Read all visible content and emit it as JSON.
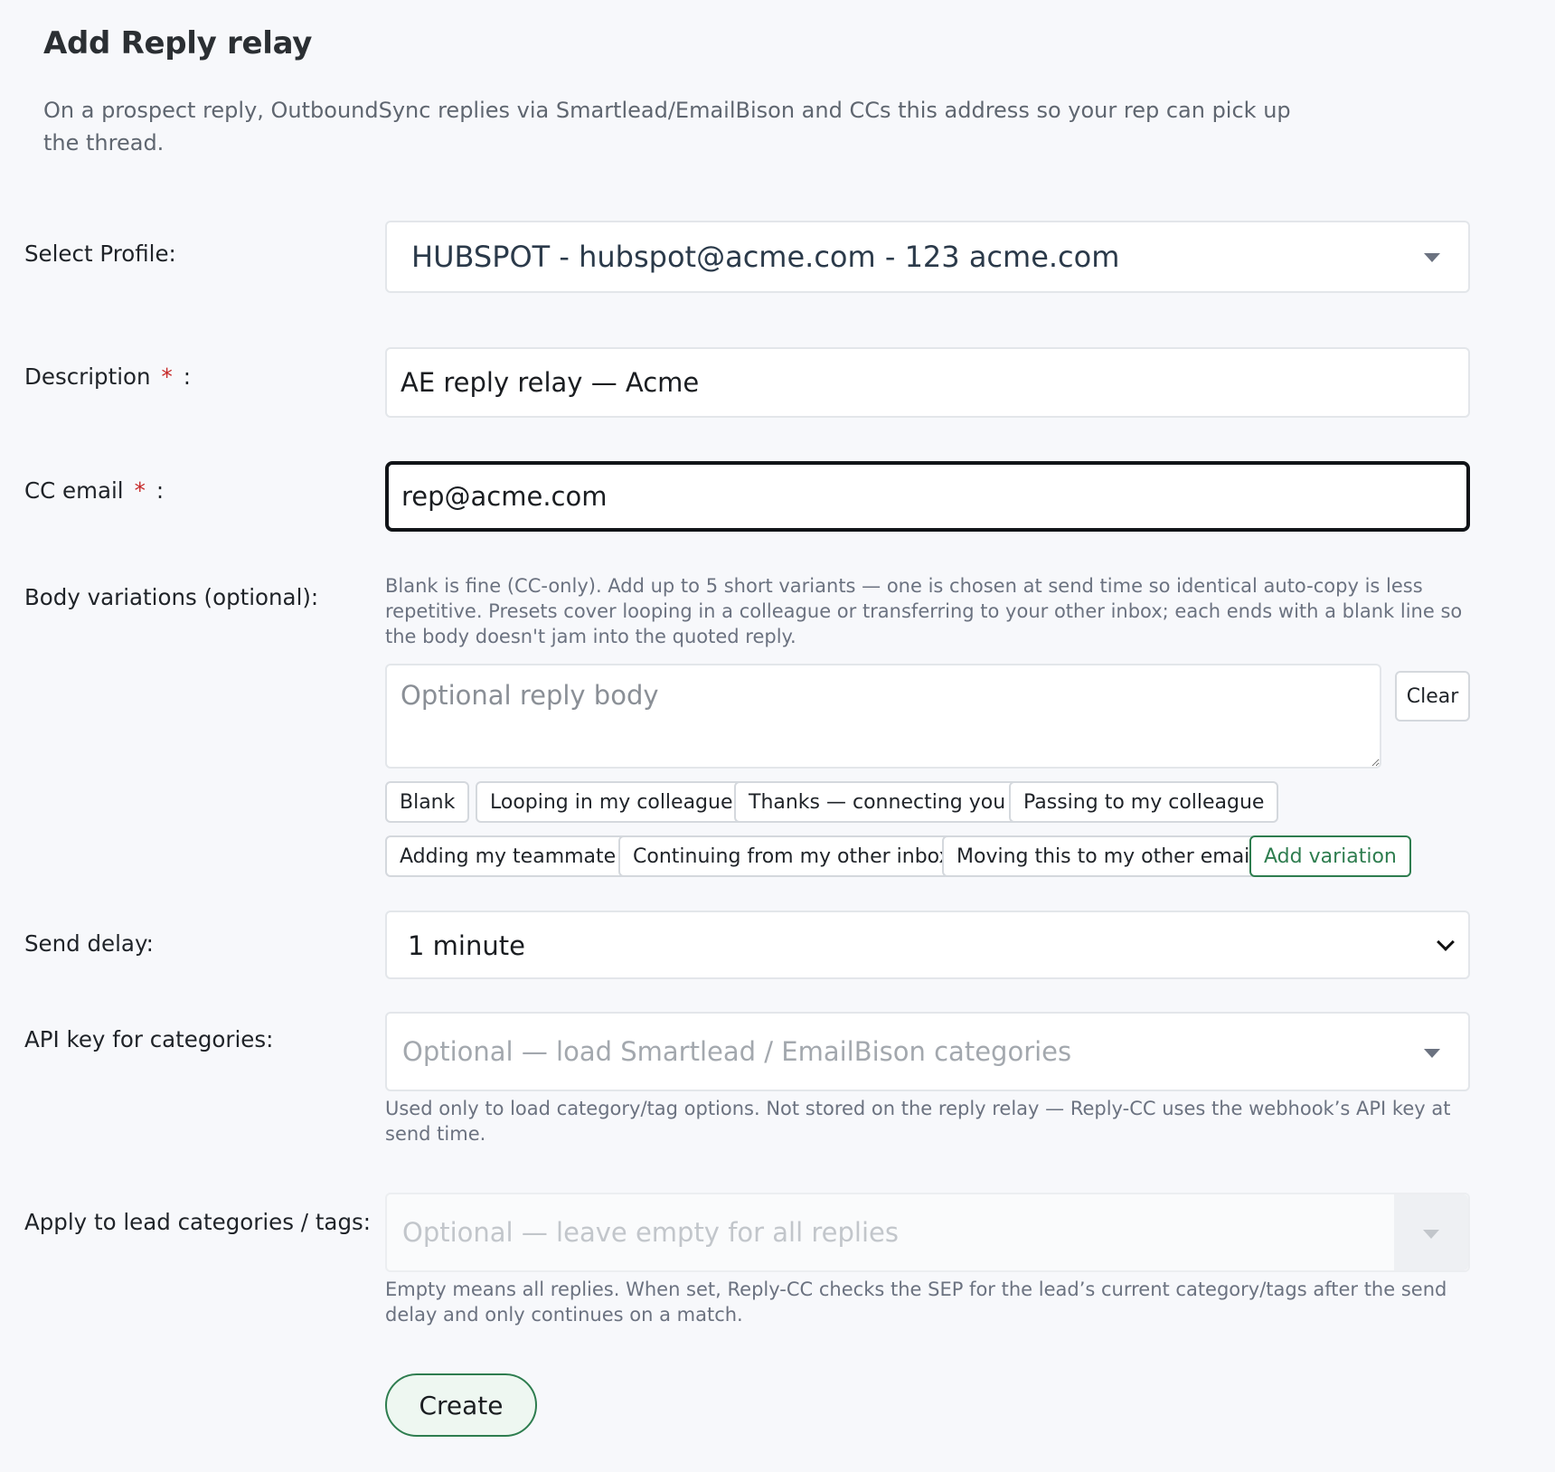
{
  "page": {
    "title": "Add Reply relay",
    "description": "On a prospect reply, OutboundSync replies via Smartlead/EmailBison and CCs this address so your rep can pick up the thread."
  },
  "profile": {
    "label": "Select Profile:",
    "value": "HUBSPOT - hubspot@acme.com - 123 acme.com"
  },
  "description_field": {
    "label": "Description",
    "required_mark": "*",
    "colon": ":",
    "value": "AE reply relay — Acme"
  },
  "cc_email": {
    "label": "CC email",
    "required_mark": "*",
    "colon": ":",
    "value": "rep@acme.com"
  },
  "body_variations": {
    "label": "Body variations (optional):",
    "help": "Blank is fine (CC-only). Add up to 5 short variants — one is chosen at send time so identical auto-copy is less repetitive. Presets cover looping in a colleague or transferring to your other inbox; each ends with a blank line so the body doesn't jam into the quoted reply.",
    "placeholder": "Optional reply body",
    "clear_label": "Clear",
    "presets": [
      "Blank",
      "Looping in my colleague",
      "Thanks — connecting you",
      "Passing to my colleague",
      "Adding my teammate",
      "Continuing from my other inbox",
      "Moving this to my other email"
    ],
    "add_label": "Add variation"
  },
  "send_delay": {
    "label": "Send delay:",
    "value": "1 minute"
  },
  "api_key": {
    "label": "API key for categories:",
    "placeholder": "Optional — load Smartlead / EmailBison categories",
    "help": "Used only to load category/tag options. Not stored on the reply relay — Reply-CC uses the webhook’s API key at send time."
  },
  "lead_tags": {
    "label": "Apply to lead categories / tags:",
    "placeholder": "Optional — leave empty for all replies",
    "help": "Empty means all replies. When set, Reply-CC checks the SEP for the lead’s current category/tags after the send delay and only continues on a match."
  },
  "create_label": "Create",
  "colors": {
    "accent_green": "#2e7d4f",
    "required_red": "#c62828",
    "background": "#f7f8fb"
  }
}
